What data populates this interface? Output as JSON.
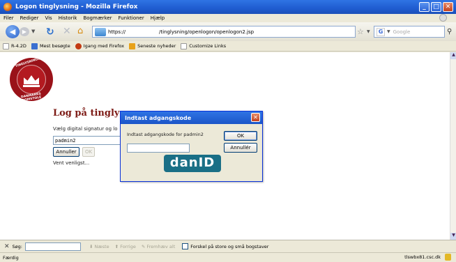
{
  "window": {
    "title": "Logon tinglysning - Mozilla Firefox"
  },
  "menu": [
    "Filer",
    "Rediger",
    "Vis",
    "Historik",
    "Bogmærker",
    "Funktioner",
    "Hjælp"
  ],
  "nav": {
    "url_scheme": "https://",
    "url_path": "/tinglysning/openlogon/openlogon2.jsp",
    "search_placeholder": "Google"
  },
  "bookmarks": [
    {
      "label": "R-4.2D",
      "color": "#3a6fd0"
    },
    {
      "label": "Mest besøgte",
      "color": "#3a6fd0"
    },
    {
      "label": "Igang med Firefox",
      "color": "#c33a12"
    },
    {
      "label": "Seneste nyheder",
      "color": "#e8a21a"
    },
    {
      "label": "Customize Links",
      "color": "#ffffff"
    }
  ],
  "logo": {
    "top_text": "TINGLYSNINGSRETTEN",
    "bottom_text": "DANMARKS DOMSTOLE"
  },
  "page": {
    "title": "Log på tinglysn",
    "instruction": "Vælg digital signatur og lo",
    "username": "padmin2",
    "cancel_label": "Annuller",
    "ok_label": "OK",
    "wait_text": "Vent venligst..."
  },
  "dialog": {
    "title": "Indtast adgangskode",
    "prompt": "Indtast adgangskode for padmin2",
    "ok_label": "OK",
    "cancel_label": "Annullér",
    "brand": "danID"
  },
  "findbar": {
    "label": "Søg:",
    "next": "Næste",
    "prev": "Forrige",
    "highlight": "Fremhæv alt",
    "match_case": "Forskel på store og små bogstaver"
  },
  "status": {
    "text": "Færdig",
    "host": "tlswbx81.csc.dk"
  }
}
